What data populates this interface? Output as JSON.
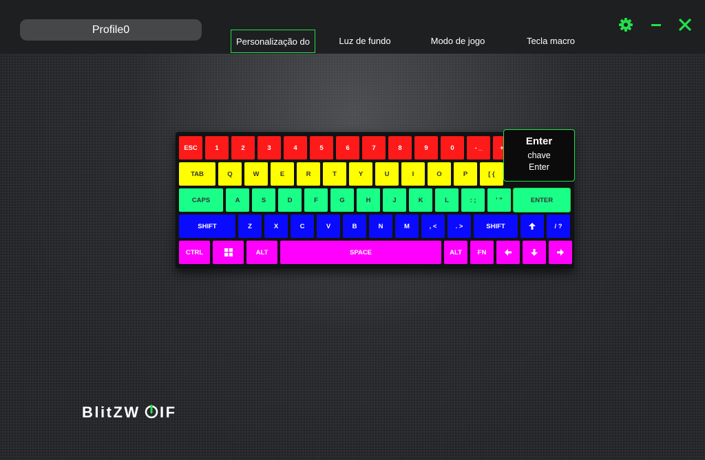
{
  "header": {
    "profile_name": "Profile0",
    "tabs": [
      {
        "label": "Personalização do",
        "active": true
      },
      {
        "label": "Luz de fundo",
        "active": false
      },
      {
        "label": "Modo de jogo",
        "active": false
      },
      {
        "label": "Tecla macro",
        "active": false
      }
    ],
    "icons": [
      "gear-icon",
      "minimize-icon",
      "close-icon"
    ],
    "accent_color": "#22e04a"
  },
  "keyboard": {
    "row_colors": [
      "#ff1a1a",
      "#ffff00",
      "#1aff88",
      "#0a0aff",
      "#ff00ff"
    ],
    "rows": [
      [
        "ESC",
        "1",
        "2",
        "3",
        "4",
        "5",
        "6",
        "7",
        "8",
        "9",
        "0",
        "- _",
        "+ ="
      ],
      [
        "TAB",
        "Q",
        "W",
        "E",
        "R",
        "T",
        "Y",
        "U",
        "I",
        "O",
        "P",
        "[ {"
      ],
      [
        "CAPS",
        "A",
        "S",
        "D",
        "F",
        "G",
        "H",
        "J",
        "K",
        "L",
        ": ;",
        "' \"",
        "ENTER"
      ],
      [
        "SHIFT",
        "Z",
        "X",
        "C",
        "V",
        "B",
        "N",
        "M",
        ", <",
        ". >",
        "SHIFT",
        "up-arrow",
        "/ ?"
      ],
      [
        "CTRL",
        "windows-icon",
        "ALT",
        "SPACE",
        "ALT",
        "FN",
        "left-arrow",
        "down-arrow",
        "right-arrow"
      ]
    ],
    "selected_key": "ENTER"
  },
  "tooltip": {
    "title": "Enter",
    "line1": "chave",
    "line2": "Enter"
  },
  "brand": {
    "logo_text": "BlitzWolf"
  }
}
